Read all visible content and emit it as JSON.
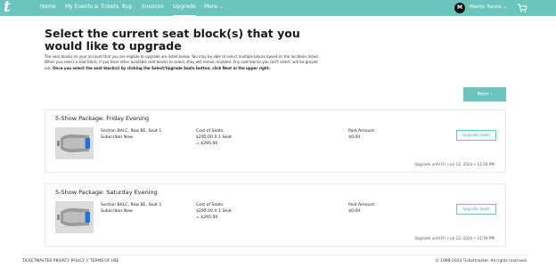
{
  "nav": {
    "logo": "t",
    "items": [
      {
        "label": "Home"
      },
      {
        "label": "My Events & Tickets"
      },
      {
        "label": "Buy"
      },
      {
        "label": "Invoices"
      },
      {
        "label": "Upgrade"
      },
      {
        "label": "More ⌄"
      }
    ],
    "avatar_initial": "M",
    "user_name": "Martin Torres ⌄",
    "active_item": "Upgrade",
    "icons": [
      "cart-icon"
    ]
  },
  "page": {
    "title": "Select the current seat block(s) that you would like to upgrade",
    "description_plain": "The seat blocks on your account that you are eligible to upgrade are listed below. You may be able to select multiple blocks based on the locations listed. When you select a seat block, if you have other available seat blocks to select, they will remain enabled. Any seat blocks you can't select, will be grayed out.",
    "description_bold": "Once you select the seat block(s) by clicking the Select/Upgrade Seats button, click Next in the upper right.",
    "next_label": "Next ›"
  },
  "cards": [
    {
      "title": "5-Show Package: Friday Evening",
      "seat": "Section BALC, Row BE, Seat 1",
      "type": "Subscriber New",
      "cost_label": "Cost of Seats:",
      "cost_line": "$295.00 X 1 Seat",
      "cost_total": "= $295.00",
      "paid_label": "Paid Amount:",
      "paid_value": "$0.00",
      "button": "Upgrade Seats",
      "until": "Upgrade until Fri • Jul 12, 2024 • 11:59 PM"
    },
    {
      "title": "5-Show Package: Saturday Evening",
      "seat": "Section BALC, Row BE, Seat 1",
      "type": "Subscriber New",
      "cost_label": "Cost of Seats:",
      "cost_line": "$295.00 X 1 Seat",
      "cost_total": "= $295.00",
      "paid_label": "Paid Amount:",
      "paid_value": "$0.00",
      "button": "Upgrade Seats",
      "until": "Upgrade until Fri • Jul 12, 2024 • 11:59 PM"
    }
  ],
  "footer": {
    "links": "TICKETMASTER PRIVACY POLICY  //  TERMS OF USE",
    "copyright": "© 1999-2024 Ticketmaster. All rights reserved."
  },
  "colors": {
    "brand": "#6cc4be",
    "seat_highlight": "#1a73e8"
  }
}
